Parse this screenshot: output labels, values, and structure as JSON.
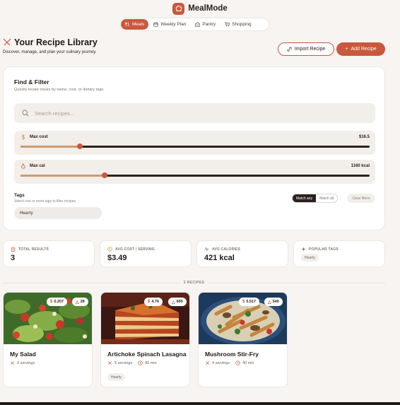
{
  "app": {
    "name": "MealMode"
  },
  "nav": {
    "tabs": [
      {
        "label": "Meals",
        "icon": "utensils-icon",
        "active": true
      },
      {
        "label": "Weekly Plan",
        "icon": "calendar-icon",
        "active": false
      },
      {
        "label": "Pantry",
        "icon": "pantry-icon",
        "active": false
      },
      {
        "label": "Shopping",
        "icon": "cart-icon",
        "active": false
      }
    ]
  },
  "header": {
    "title": "Your Recipe Library",
    "subtitle": "Discover, manage, and plan your culinary journey.",
    "import_label": "Import Recipe",
    "add_label": "Add Recipe"
  },
  "filter": {
    "title": "Find & Filter",
    "subtitle": "Quickly locate meals by name, cost, or dietary tags.",
    "search_placeholder": "Search recipes...",
    "search_value": "",
    "max_cost": {
      "label": "Max cost",
      "value": "$16.5",
      "fraction": 0.17
    },
    "max_cal": {
      "label": "Max cal",
      "value": "1160 kcal",
      "fraction": 0.24
    },
    "tags_title": "Tags",
    "tags_subtitle": "Select one or more tags to filter recipes.",
    "tags": [
      "Hearty"
    ],
    "match_any": "Match any",
    "match_all": "Match all",
    "match_mode": "any",
    "clear_label": "Clear filters"
  },
  "stats": {
    "total_results": {
      "label": "TOTAL RESULTS",
      "value": "3"
    },
    "avg_cost": {
      "label": "AVG COST / SERVING",
      "value": "$3.49"
    },
    "avg_calories": {
      "label": "AVG CALORIES",
      "value": "421 kcal"
    },
    "popular_tags": {
      "label": "POPULAR TAGS",
      "tags": [
        "Hearty"
      ]
    }
  },
  "results_label": "3 RECIPES",
  "recipes": [
    {
      "title": "My Salad",
      "cost": "0.207",
      "calories": "28",
      "servings": "3 servings",
      "time": "",
      "tags": []
    },
    {
      "title": "Artichoke Spinach Lasagna",
      "cost": "4.76",
      "calories": "695",
      "servings": "5 servings",
      "time": "80 min",
      "tags": [
        "Hearty"
      ]
    },
    {
      "title": "Mushroom Stir-Fry",
      "cost": "5.517",
      "calories": "540",
      "servings": "4 servings",
      "time": "40 min",
      "tags": []
    }
  ],
  "colors": {
    "accent": "#c9583c",
    "dark": "#2a211c",
    "background": "#f7f4f1"
  }
}
